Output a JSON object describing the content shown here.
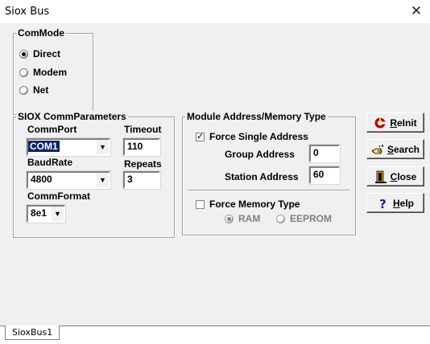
{
  "window": {
    "title": "Siox Bus",
    "close_glyph": "✕"
  },
  "commmode": {
    "title": "ComMode",
    "options": [
      {
        "label": "Direct",
        "selected": true
      },
      {
        "label": "Modem",
        "selected": false
      },
      {
        "label": "Net",
        "selected": false
      }
    ]
  },
  "params": {
    "title": "SIOX CommParameters",
    "commport_label": "CommPort",
    "commport_value": "COM1",
    "timeout_label": "Timeout",
    "timeout_value": "110",
    "baudrate_label": "BaudRate",
    "baudrate_value": "4800",
    "repeats_label": "Repeats",
    "repeats_value": "3",
    "commformat_label": "CommFormat",
    "commformat_value": "8e1"
  },
  "module": {
    "title": "Module Address/Memory Type",
    "force_single_label": "Force Single Address",
    "force_single_checked": true,
    "group_label": "Group Address",
    "group_value": "0",
    "station_label": "Station Address",
    "station_value": "60",
    "force_memory_label": "Force Memory Type",
    "force_memory_checked": false,
    "ram_label": "RAM",
    "eeprom_label": "EEPROM"
  },
  "buttons": {
    "reinit_prefix": "",
    "reinit_u": "R",
    "reinit_rest": "eInit",
    "search_u": "S",
    "search_rest": "earch",
    "close_u": "C",
    "close_rest": "lose",
    "help_u": "H",
    "help_rest": "elp"
  },
  "tabs": [
    {
      "label": "SioxBus1"
    }
  ],
  "icons": {
    "reinit": "reinit-icon",
    "search": "search-hand-icon",
    "close": "close-door-icon",
    "help": "help-question-icon"
  },
  "colors": {
    "selection": "#0a246a",
    "dialog_bg": "#f0f0f0",
    "reinit_icon": "#c00000",
    "help_icon": "#1a1a8c"
  }
}
